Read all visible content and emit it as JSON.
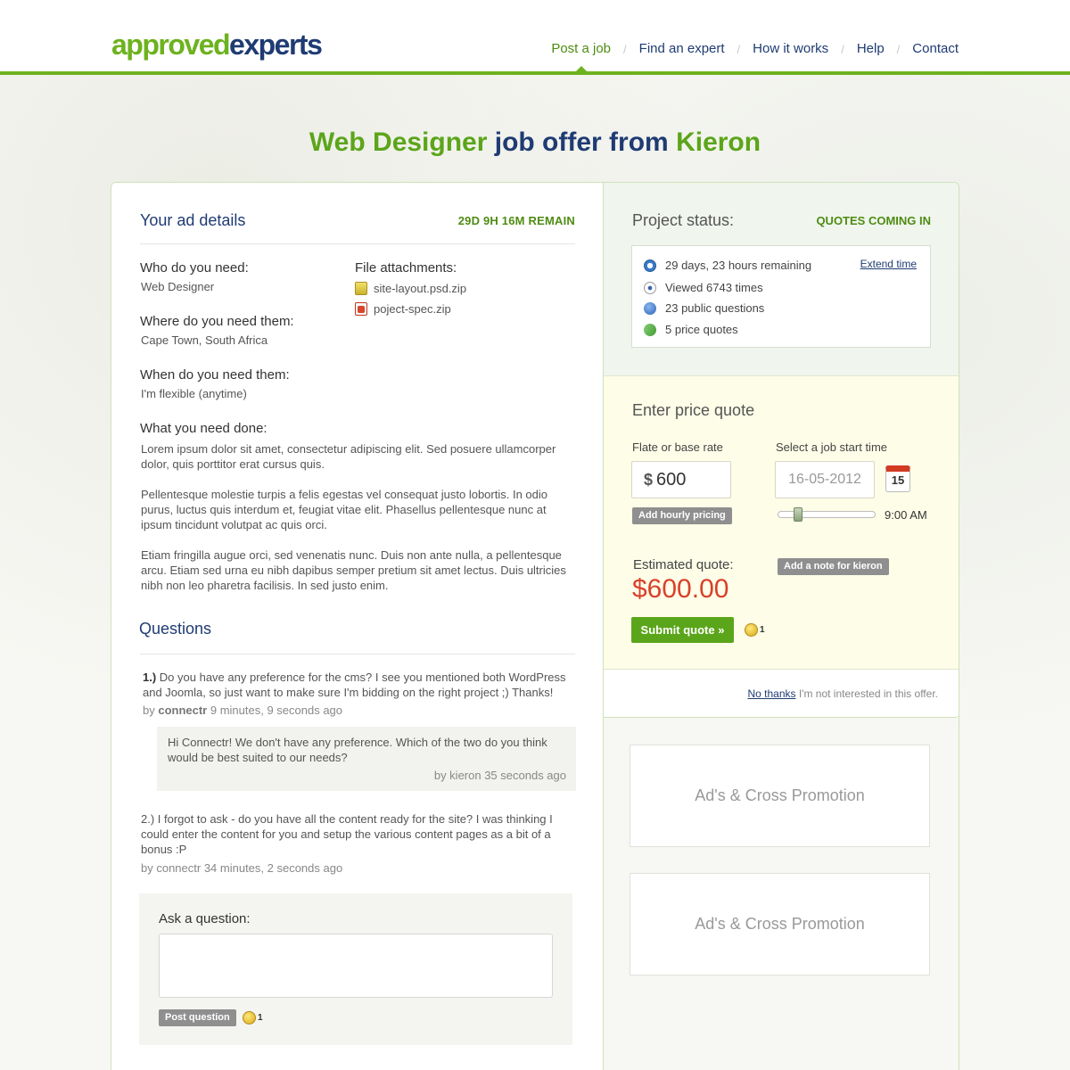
{
  "logo": {
    "part1": "approved",
    "part2": "experts"
  },
  "nav": {
    "items": [
      "Post a job",
      "Find an expert",
      "How it works",
      "Help",
      "Contact"
    ],
    "separator": "/"
  },
  "title": {
    "role": "Web Designer",
    "middle": " job offer from ",
    "name": "Kieron"
  },
  "ad": {
    "heading": "Your ad details",
    "remain": "29D 9H 16M REMAIN",
    "who_label": "Who do you need:",
    "who_value": "Web Designer",
    "where_label": "Where do you need them:",
    "where_value": "Cape Town, South Africa",
    "when_label": "When do you need them:",
    "when_value": "I'm flexible (anytime)",
    "what_label": "What you need done:",
    "paragraphs": [
      "Lorem ipsum dolor sit amet, consectetur adipiscing elit. Sed posuere ullamcorper dolor, quis porttitor erat cursus quis.",
      "Pellentesque molestie turpis a felis egestas vel consequat justo lobortis. In odio purus, luctus quis interdum et, feugiat vitae elit. Phasellus pellentesque nunc at ipsum tincidunt volutpat ac quis orci.",
      "Etiam fringilla augue orci, sed venenatis nunc. Duis non ante nulla, a pellentesque arcu. Etiam sed urna eu nibh dapibus semper pretium sit amet lectus. Duis ultricies nibh non leo pharetra facilisis. In sed justo enim."
    ],
    "files_label": "File attachments:",
    "files": [
      {
        "name": "site-layout.psd.zip",
        "icon": "zip-icon"
      },
      {
        "name": "poject-spec.zip",
        "icon": "pdf-icon"
      }
    ]
  },
  "questions": {
    "heading": "Questions",
    "q1": {
      "num": "1.)",
      "text": " Do you have any preference for the cms? I see you mentioned both WordPress and Joomla, so just want to make sure I'm bidding on the right project ;) Thanks!",
      "by": "by ",
      "author": "connectr",
      "time": " 9 minutes, 9 seconds ago"
    },
    "reply": {
      "text": "Hi Connectr! We don't have any preference. Which of the two do you think would be best suited to our needs?",
      "meta": "by kieron 35 seconds ago"
    },
    "q2": {
      "text": "2.) I forgot to ask - do you have all the content ready for the site? I was thinking I could enter the content for you and setup the various content pages as a bit of a bonus :P",
      "meta": "by connectr 34 minutes, 2 seconds ago"
    },
    "ask_label": "Ask a question:",
    "ask_placeholder": "",
    "post_button": "Post question",
    "coin_count": "1"
  },
  "status": {
    "title": "Project status:",
    "value": "QUOTES COMING IN",
    "remaining": "29 days, 23 hours remaining",
    "extend": "Extend time",
    "views": "Viewed 6743 times",
    "questions": "23 public questions",
    "quotes": "5 price quotes"
  },
  "quote": {
    "title": "Enter price quote",
    "rate_label": "Flate or base rate",
    "currency": "$",
    "rate_value": "600",
    "hourly_button": "Add hourly pricing",
    "start_label": "Select a job start time",
    "date_value": "16-05-2012",
    "calendar_day": "15",
    "time_value": "9:00 AM",
    "time_slider_fraction": 0.2,
    "note_button": "Add a note for kieron",
    "est_label": "Estimated quote:",
    "est_value": "$600.00",
    "submit_button": "Submit quote »",
    "coin_count": "1",
    "no_thanks_link": "No thanks",
    "no_thanks_text": " I'm not interested in this offer."
  },
  "ads": [
    "Ad's & Cross Promotion",
    "Ad's & Cross Promotion"
  ],
  "colors": {
    "accent": "#6db21f",
    "navy": "#1f3b73",
    "price": "#d9412b"
  }
}
